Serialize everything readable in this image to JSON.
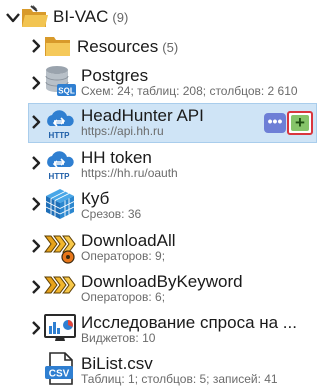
{
  "tree": {
    "root": {
      "title": "BI-VAC",
      "count": "(9)",
      "icon": "folder-open-icon"
    },
    "items": [
      {
        "title": "Resources",
        "count": "(5)",
        "icon": "folder-icon"
      },
      {
        "title": "Postgres",
        "subtitle": "Схем: 24; таблиц: 208; столбцов: 2 610",
        "icon": "sql-database-icon"
      },
      {
        "title": "HeadHunter API",
        "subtitle": "https://api.hh.ru",
        "icon": "http-cloud-icon",
        "selected": true
      },
      {
        "title": "HH token",
        "subtitle": "https://hh.ru/oauth",
        "icon": "http-cloud-icon"
      },
      {
        "title": "Куб",
        "subtitle": "Срезов: 36",
        "icon": "cube-icon"
      },
      {
        "title": "DownloadAll",
        "subtitle": "Операторов: 9;",
        "icon": "pipeline-icon"
      },
      {
        "title": "DownloadByKeyword",
        "subtitle": "Операторов: 6;",
        "icon": "pipeline-icon"
      },
      {
        "title": "Исследование спроса на ...",
        "subtitle": "Виджетов: 10",
        "icon": "dashboard-icon"
      },
      {
        "title": "BiList.csv",
        "subtitle": "Таблиц: 1; столбцов: 5; записей: 41",
        "icon": "csv-file-icon"
      }
    ],
    "actions": {
      "more_label": "•••",
      "add_label": "+"
    },
    "icon_labels": {
      "sql": "SQL",
      "http": "HTTP",
      "csv": "CSV"
    }
  },
  "colors": {
    "selection_bg": "#cfe4f6",
    "selection_border": "#a9cdec",
    "more_button": "#6e7fd6",
    "add_button": "#86c46a",
    "add_button_highlight": "#d9363e"
  }
}
